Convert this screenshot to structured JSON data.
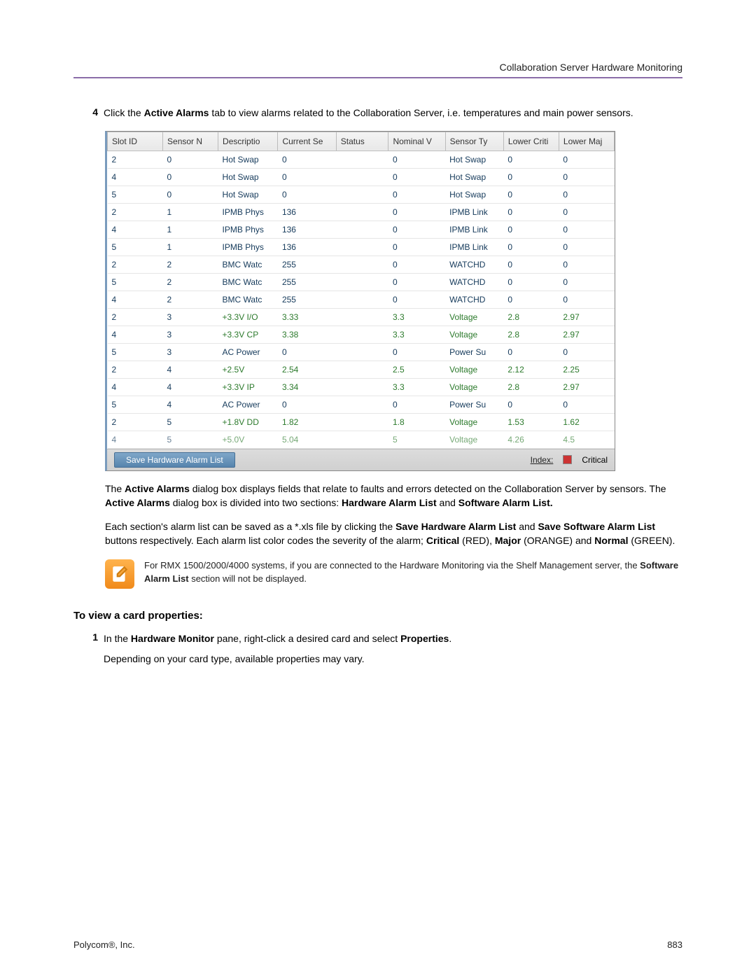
{
  "header": {
    "title": "Collaboration Server Hardware Monitoring"
  },
  "step4": {
    "num": "4",
    "pre": "Click the ",
    "bold1": "Active Alarms",
    "post": " tab to view alarms related to the Collaboration Server, i.e. temperatures and main power sensors."
  },
  "table": {
    "columns": [
      "Slot ID",
      "Sensor N",
      "Descriptio",
      "Current Se",
      "Status",
      "Nominal V",
      "Sensor Ty",
      "Lower Criti",
      "Lower Maj"
    ],
    "rows": [
      {
        "slot": "2",
        "sensor": "0",
        "desc": "Hot Swap",
        "curr": "0",
        "status": "",
        "nom": "0",
        "type": "Hot Swap",
        "lc": "0",
        "lm": "0",
        "voltage": false
      },
      {
        "slot": "4",
        "sensor": "0",
        "desc": "Hot Swap",
        "curr": "0",
        "status": "",
        "nom": "0",
        "type": "Hot Swap",
        "lc": "0",
        "lm": "0",
        "voltage": false
      },
      {
        "slot": "5",
        "sensor": "0",
        "desc": "Hot Swap",
        "curr": "0",
        "status": "",
        "nom": "0",
        "type": "Hot Swap",
        "lc": "0",
        "lm": "0",
        "voltage": false
      },
      {
        "slot": "2",
        "sensor": "1",
        "desc": "IPMB Phys",
        "curr": "136",
        "status": "",
        "nom": "0",
        "type": "IPMB Link",
        "lc": "0",
        "lm": "0",
        "voltage": false
      },
      {
        "slot": "4",
        "sensor": "1",
        "desc": "IPMB Phys",
        "curr": "136",
        "status": "",
        "nom": "0",
        "type": "IPMB Link",
        "lc": "0",
        "lm": "0",
        "voltage": false
      },
      {
        "slot": "5",
        "sensor": "1",
        "desc": "IPMB Phys",
        "curr": "136",
        "status": "",
        "nom": "0",
        "type": "IPMB Link",
        "lc": "0",
        "lm": "0",
        "voltage": false
      },
      {
        "slot": "2",
        "sensor": "2",
        "desc": "BMC Watc",
        "curr": "255",
        "status": "",
        "nom": "0",
        "type": "WATCHD",
        "lc": "0",
        "lm": "0",
        "voltage": false
      },
      {
        "slot": "5",
        "sensor": "2",
        "desc": "BMC Watc",
        "curr": "255",
        "status": "",
        "nom": "0",
        "type": "WATCHD",
        "lc": "0",
        "lm": "0",
        "voltage": false
      },
      {
        "slot": "4",
        "sensor": "2",
        "desc": "BMC Watc",
        "curr": "255",
        "status": "",
        "nom": "0",
        "type": "WATCHD",
        "lc": "0",
        "lm": "0",
        "voltage": false
      },
      {
        "slot": "2",
        "sensor": "3",
        "desc": "+3.3V I/O",
        "curr": "3.33",
        "status": "",
        "nom": "3.3",
        "type": "Voltage",
        "lc": "2.8",
        "lm": "2.97",
        "voltage": true
      },
      {
        "slot": "4",
        "sensor": "3",
        "desc": "+3.3V CP",
        "curr": "3.38",
        "status": "",
        "nom": "3.3",
        "type": "Voltage",
        "lc": "2.8",
        "lm": "2.97",
        "voltage": true
      },
      {
        "slot": "5",
        "sensor": "3",
        "desc": "AC Power",
        "curr": "0",
        "status": "",
        "nom": "0",
        "type": "Power Su",
        "lc": "0",
        "lm": "0",
        "voltage": false
      },
      {
        "slot": "2",
        "sensor": "4",
        "desc": "+2.5V",
        "curr": "2.54",
        "status": "",
        "nom": "2.5",
        "type": "Voltage",
        "lc": "2.12",
        "lm": "2.25",
        "voltage": true
      },
      {
        "slot": "4",
        "sensor": "4",
        "desc": "+3.3V IP",
        "curr": "3.34",
        "status": "",
        "nom": "3.3",
        "type": "Voltage",
        "lc": "2.8",
        "lm": "2.97",
        "voltage": true
      },
      {
        "slot": "5",
        "sensor": "4",
        "desc": "AC Power",
        "curr": "0",
        "status": "",
        "nom": "0",
        "type": "Power Su",
        "lc": "0",
        "lm": "0",
        "voltage": false
      },
      {
        "slot": "2",
        "sensor": "5",
        "desc": "+1.8V DD",
        "curr": "1.82",
        "status": "",
        "nom": "1.8",
        "type": "Voltage",
        "lc": "1.53",
        "lm": "1.62",
        "voltage": true
      },
      {
        "slot": "4",
        "sensor": "5",
        "desc": "+5.0V",
        "curr": "5.04",
        "status": "",
        "nom": "5",
        "type": "Voltage",
        "lc": "4.26",
        "lm": "4.5",
        "voltage": true
      }
    ]
  },
  "footerBar": {
    "saveLabel": "Save Hardware Alarm List",
    "indexLabel": "Index:",
    "critical": "Critical"
  },
  "para1": {
    "t1": "The ",
    "b1": "Active Alarms",
    "t2": " dialog box displays fields that relate to faults and errors detected on the Collaboration Server by sensors. The ",
    "b2": "Active Alarms",
    "t3": " dialog box is divided into two sections: ",
    "b3": "Hardware Alarm List",
    "t4": " and ",
    "b4": "Software Alarm List.",
    "t5": ""
  },
  "para2": {
    "t1": "Each section's alarm list can be saved as a *.xls file by clicking the ",
    "b1": "Save Hardware Alarm List",
    "t2": " and ",
    "b2": "Save Software Alarm List",
    "t3": " buttons respectively. Each alarm list color codes the severity of the alarm; ",
    "b3": "Critical",
    "t4": " (RED), ",
    "b4": "Major",
    "t5": " (ORANGE) and ",
    "b5": "Normal",
    "t6": " (GREEN)."
  },
  "note": {
    "t1": "For RMX 1500/2000/4000 systems, if you are connected to the Hardware Monitoring via the Shelf Management server, the ",
    "b1": "Software Alarm List",
    "t2": " section will not be displayed."
  },
  "subheading": "To view a card properties:",
  "step1b": {
    "num": "1",
    "t1": "In the ",
    "b1": "Hardware Monitor",
    "t2": " pane, right-click a desired card and select ",
    "b2": "Properties",
    "t3": ".",
    "line2": "Depending on your card type, available properties may vary."
  },
  "pagefoot": {
    "left": "Polycom®, Inc.",
    "right": "883"
  }
}
